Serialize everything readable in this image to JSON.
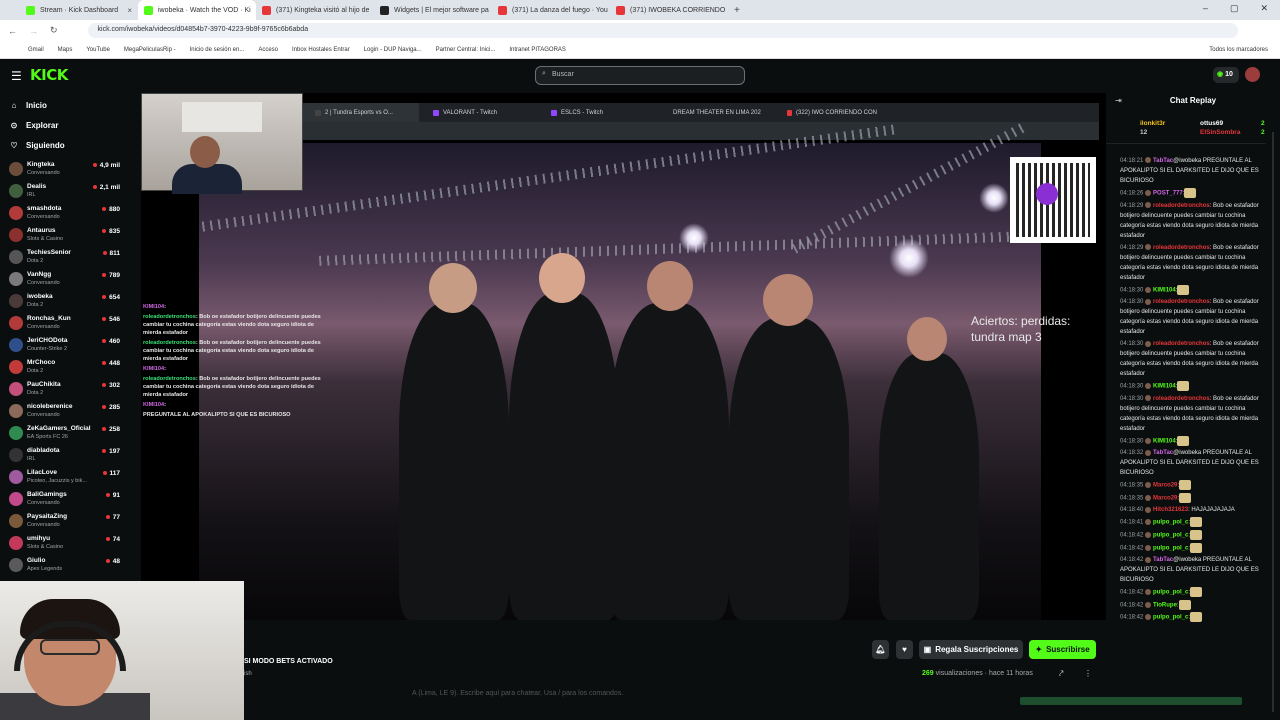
{
  "browser": {
    "tabs": [
      {
        "label": "Stream · Kick Dashboard",
        "color": "#53fc18",
        "active": false
      },
      {
        "label": "iwobeka · Watch the VOD · Ki",
        "color": "#53fc18",
        "active": true
      },
      {
        "label": "(371) Kingteka visitó al hijo de ",
        "color": "#e6363a",
        "active": false
      },
      {
        "label": "Widgets | El mejor software pa",
        "color": "#222222",
        "active": false
      },
      {
        "label": "(371) La danza del fuego · You",
        "color": "#e6363a",
        "active": false
      },
      {
        "label": "(371) IWOBEKA CORRIENDO",
        "color": "#e6363a",
        "active": false
      }
    ],
    "url": "kick.com/iwobeka/videos/d04854b7-3970-4223-9b9f-9765c6b6abda",
    "bookmarks": [
      "Gmail",
      "Maps",
      "YouTube",
      "MegaPeliculasRip -",
      "Inicio de sesión en...",
      "Acceso",
      "Inbox Hostales Entrar",
      "Login - DUP Naviga...",
      "Partner Central: Inici...",
      "Intranet PITAGORAS"
    ],
    "other_bookmarks": "Todos los marcadores"
  },
  "header": {
    "logo": "KICK",
    "search_placeholder": "Buscar",
    "points": "10"
  },
  "sidebar": {
    "nav": [
      {
        "label": "Inicio",
        "icon": "home-icon"
      },
      {
        "label": "Explorar",
        "icon": "compass-icon"
      },
      {
        "label": "Siguiendo",
        "icon": "heart-icon"
      }
    ],
    "channels": [
      {
        "name": "Kingteka",
        "category": "Conversando",
        "viewers": "4,9 mil",
        "color": "#6b4d3a"
      },
      {
        "name": "Dealis",
        "category": "IRL",
        "viewers": "2,1 mil",
        "color": "#3f5f3f"
      },
      {
        "name": "smashdota",
        "category": "Conversando",
        "viewers": "880",
        "color": "#b23a3a"
      },
      {
        "name": "Antaurus",
        "category": "Slots & Casino",
        "viewers": "835",
        "color": "#8b2f2f"
      },
      {
        "name": "TechiesSenior",
        "category": "Dota 2",
        "viewers": "811",
        "color": "#555555"
      },
      {
        "name": "VanNgg",
        "category": "Conversando",
        "viewers": "789",
        "color": "#7a7a7a"
      },
      {
        "name": "iwobeka",
        "category": "Dota 2",
        "viewers": "654",
        "color": "#4b3a3a"
      },
      {
        "name": "Ronchas_Kun",
        "category": "Conversando",
        "viewers": "546",
        "color": "#b23a3a"
      },
      {
        "name": "JeriCHODota",
        "category": "Counter-Strike 2",
        "viewers": "460",
        "color": "#2f4f8b"
      },
      {
        "name": "MrChoco",
        "category": "Dota 2",
        "viewers": "448",
        "color": "#c23a3a"
      },
      {
        "name": "PauChikita",
        "category": "Dota 2",
        "viewers": "302",
        "color": "#c2507a"
      },
      {
        "name": "nicoleberenice",
        "category": "Conversando",
        "viewers": "285",
        "color": "#8b6a5a"
      },
      {
        "name": "ZeKaGamers_Oficial",
        "category": "EA Sports FC 26",
        "viewers": "258",
        "color": "#2f8b4f"
      },
      {
        "name": "diabladota",
        "category": "IRL",
        "viewers": "197",
        "color": "#333333"
      },
      {
        "name": "LilacLove",
        "category": "Picoteo, Jacuzzis y bik...",
        "viewers": "117",
        "color": "#a05aa0"
      },
      {
        "name": "BaliGamings",
        "category": "Conversando",
        "viewers": "91",
        "color": "#c24a8a"
      },
      {
        "name": "PaysaitaZing",
        "category": "Conversando",
        "viewers": "77",
        "color": "#7a5a3a"
      },
      {
        "name": "umihyu",
        "category": "Slots & Casino",
        "viewers": "74",
        "color": "#c23a5a"
      },
      {
        "name": "Giulio",
        "category": "Apex Legends",
        "viewers": "48",
        "color": "#5a5a5a"
      }
    ]
  },
  "player": {
    "inner_tabs": [
      "2 | Tundra Esports vs O...",
      "VALORANT - Twitch",
      "ESLCS - Twitch",
      "DREAM THEATER EN LIMA 202",
      "(322) IWO CORRIENDO CON"
    ],
    "overlay_text_1": "Aciertos: perdidas:",
    "overlay_text_2": "tundra map 3",
    "chat_overlay": [
      {
        "user": "KIMI104",
        "text": ":"
      },
      {
        "user": "roleadordetronchos",
        "text": ": Bob oe estafador botijero delincuente puedes cambiar tu cochina categoría estas viendo dota seguro idiota de mierda estafador"
      },
      {
        "user": "roleadordetronchos",
        "text": ": Bob oe estafador botijero delincuente puedes cambiar tu cochina categoría estas viendo dota seguro idiota de mierda estafador"
      },
      {
        "user": "KIMI104",
        "text": ":"
      },
      {
        "user": "roleadordetronchos",
        "text": ": Bob oe estafador botijero delincuente puedes cambiar tu cochina categoría estas viendo dota seguro idiota de mierda estafador"
      },
      {
        "user": "KIMI104",
        "text": ":"
      },
      {
        "user": "",
        "text": "PREGUNTALE AL APOKALIPTO SI QUE ES BICURIOSO"
      }
    ]
  },
  "video_info": {
    "title": "SI MODO BETS ACTIVADO",
    "subtitle": "ish",
    "gift_label": "Regala Suscripciones",
    "subscribe_label": "Suscribirse",
    "views": "269",
    "views_label": "visualizaciones",
    "time": "hace 11 horas",
    "command_hint": "A (Lima, LE 9). Escribe aquí para chatear. Usa / para los comandos."
  },
  "chat": {
    "title": "Chat Replay",
    "pinned": [
      {
        "user": "ilonkit3r",
        "count": "12"
      },
      {
        "user": "ottus69",
        "count": "2"
      },
      {
        "user": "ElSinSombra",
        "count": "2"
      }
    ],
    "messages": [
      {
        "time": "04:18:21",
        "user": "TabTac",
        "style": "un",
        "text": "@iwobeka PREGUNTALE AL APOKALIPTO SI EL DARKSITED LE DIJO QUE ES BICURIOSO"
      },
      {
        "time": "04:18:26",
        "user": "POST_777",
        "style": "un",
        "text": ":"
      },
      {
        "time": "04:18:29",
        "user": "roleadordetronchos",
        "style": "ur",
        "text": ": Bob oe estafador botijero delincuente puedes cambiar tu cochina categoría estas viendo dota seguro idiota de mierda estafador"
      },
      {
        "time": "04:18:29",
        "user": "roleadordetronchos",
        "style": "ur",
        "text": ": Bob oe estafador botijero delincuente puedes cambiar tu cochina categoría estas viendo dota seguro idiota de mierda estafador"
      },
      {
        "time": "04:18:30",
        "user": "KIMI104",
        "style": "ug",
        "text": ":"
      },
      {
        "time": "04:18:30",
        "user": "roleadordetronchos",
        "style": "ur",
        "text": ": Bob oe estafador botijero delincuente puedes cambiar tu cochina categoría estas viendo dota seguro idiota de mierda estafador"
      },
      {
        "time": "04:18:30",
        "user": "roleadordetronchos",
        "style": "ur",
        "text": ": Bob oe estafador botijero delincuente puedes cambiar tu cochina categoría estas viendo dota seguro idiota de mierda estafador"
      },
      {
        "time": "04:18:30",
        "user": "KIMI104",
        "style": "ug",
        "text": ":"
      },
      {
        "time": "04:18:30",
        "user": "roleadordetronchos",
        "style": "ur",
        "text": ": Bob oe estafador botijero delincuente puedes cambiar tu cochina categoría estas viendo dota seguro idiota de mierda estafador"
      },
      {
        "time": "04:18:30",
        "user": "KIMI104",
        "style": "ug",
        "text": ":"
      },
      {
        "time": "04:18:32",
        "user": "TabTac",
        "style": "un",
        "text": "@iwobeka PREGUNTALE AL APOKALIPTO SI EL DARKSITED LE DIJO QUE ES BICURIOSO"
      },
      {
        "time": "04:18:35",
        "user": "Marco29",
        "style": "ur",
        "text": ":"
      },
      {
        "time": "04:18:35",
        "user": "Marco29",
        "style": "ur",
        "text": ":"
      },
      {
        "time": "04:18:40",
        "user": "Hitch321623",
        "style": "ur",
        "text": ": HAJAJAJAJAJA"
      },
      {
        "time": "04:18:41",
        "user": "pulpo_pol_c",
        "style": "ug",
        "text": ":"
      },
      {
        "time": "04:18:42",
        "user": "pulpo_pol_c",
        "style": "ug",
        "text": ":"
      },
      {
        "time": "04:18:42",
        "user": "pulpo_pol_c",
        "style": "ug",
        "text": ":"
      },
      {
        "time": "04:18:42",
        "user": "TabTac",
        "style": "un",
        "text": "@iwobeka PREGUNTALE AL APOKALIPTO SI EL DARKSITED LE DIJO QUE ES BICURIOSO"
      },
      {
        "time": "04:18:42",
        "user": "pulpo_pol_c",
        "style": "ug",
        "text": ":"
      },
      {
        "time": "04:18:42",
        "user": "TioRupe",
        "style": "ug",
        "text": ":"
      },
      {
        "time": "04:18:42",
        "user": "pulpo_pol_c",
        "style": "ug",
        "text": ":"
      }
    ]
  }
}
